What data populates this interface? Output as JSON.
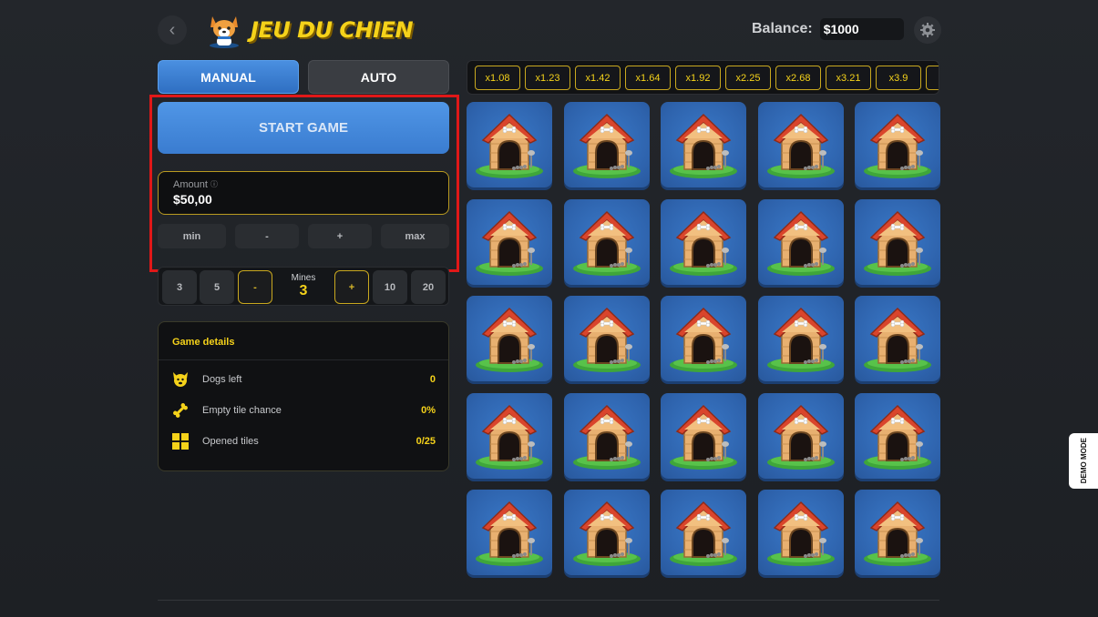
{
  "header": {
    "title": "JEU DU CHIEN",
    "balance_label": "Balance:",
    "balance_value": "$1000"
  },
  "tabs": [
    {
      "label": "MANUAL",
      "active": true
    },
    {
      "label": "AUTO",
      "active": false
    }
  ],
  "bet": {
    "start_label": "START GAME",
    "amount_label": "Amount",
    "amount_value": "$50,00",
    "adjust": [
      "min",
      "-",
      "+",
      "max"
    ]
  },
  "mines": {
    "label": "Mines",
    "value": "3",
    "presets": [
      "3",
      "5",
      "-",
      "+",
      "10",
      "20"
    ]
  },
  "details": {
    "title": "Game details",
    "rows": [
      {
        "icon": "dog-face-icon",
        "label": "Dogs left",
        "value": "0"
      },
      {
        "icon": "bone-icon",
        "label": "Empty tile chance",
        "value": "0%"
      },
      {
        "icon": "grid-icon",
        "label": "Opened tiles",
        "value": "0/25"
      }
    ]
  },
  "multipliers": [
    "x1.08",
    "x1.23",
    "x1.42",
    "x1.64",
    "x1.92",
    "x2.25",
    "x2.68",
    "x3.21",
    "x3.9"
  ],
  "board": {
    "rows": 5,
    "cols": 5,
    "tile_icon": "doghouse-icon"
  },
  "demo_label": "DEMO MODE",
  "colors": {
    "accent": "#f5d21a",
    "primary": "#3a7cd0",
    "highlight": "#e01818",
    "tile": "#2e63ad"
  }
}
